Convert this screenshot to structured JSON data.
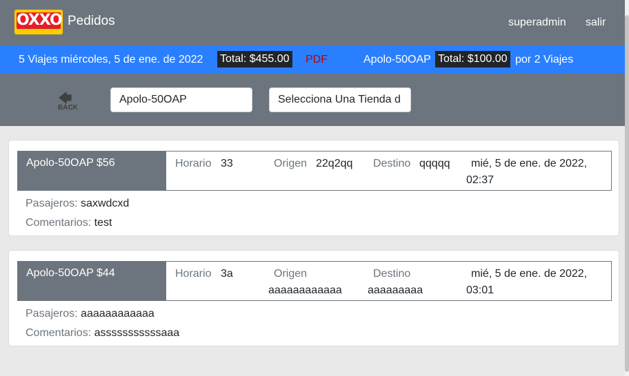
{
  "header": {
    "logo_text": "OXXO",
    "app_title": "Pedidos",
    "user": "superadmin",
    "logout": "salir"
  },
  "summary": {
    "trips_text": "5  Viajes miércoles, 5 de ene. de 2022",
    "total_badge": "Total: $455.00",
    "pdf": "PDF",
    "vehicle": "Apolo-50OAP",
    "vehicle_total_badge": "Total: $100.00",
    "per_trips": "por 2 Viajes"
  },
  "filters": {
    "back_label": "BACK",
    "vehicle_value": "Apolo-50OAP",
    "store_select": "Selecciona Una Tienda d"
  },
  "labels": {
    "horario": "Horario",
    "origen": "Origen",
    "destino": "Destino",
    "pasajeros": "Pasajeros:",
    "comentarios": "Comentarios:"
  },
  "trips": [
    {
      "title": "Apolo-50OAP $56",
      "horario": "33",
      "origen": "22q2qq",
      "destino": "qqqqq",
      "date_line1": "mié, 5 de ene. de 2022,",
      "date_line2": "02:37",
      "pasajeros": "saxwdcxd",
      "comentarios": "test"
    },
    {
      "title": "Apolo-50OAP $44",
      "horario": "3a",
      "origen": "aaaaaaaaaaaa",
      "destino": "aaaaaaaaa",
      "date_line1": "mié, 5 de ene. de 2022,",
      "date_line2": "03:01",
      "pasajeros": "aaaaaaaaaaaa",
      "comentarios": "asssssssssssaaa"
    }
  ]
}
